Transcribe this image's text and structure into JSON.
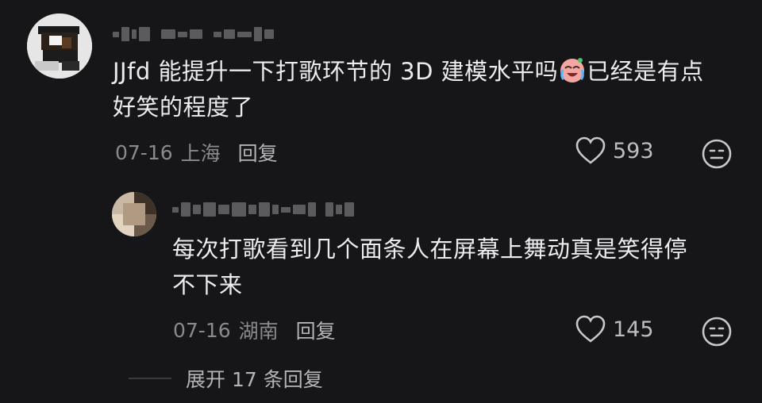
{
  "comments": [
    {
      "text_line1": "JJfd 能提升一下打歌环节的 3D 建模水平吗",
      "text_after_emoji": "已经是有点",
      "text_line2": "好笑的程度了",
      "emoji": "crying-laughing-emoji",
      "date": "07-16",
      "location": "上海",
      "reply_label": "回复",
      "likes": "593"
    },
    {
      "text_line1": "每次打歌看到几个面条人在屏幕上舞动真是笑得停",
      "text_line2": "不下来",
      "date": "07-16",
      "location": "湖南",
      "reply_label": "回复",
      "likes": "145"
    }
  ],
  "expand_label": "展开 17 条回复",
  "colors": {
    "background": "#161618",
    "text": "#ececee",
    "meta": "#8a8a8d"
  }
}
